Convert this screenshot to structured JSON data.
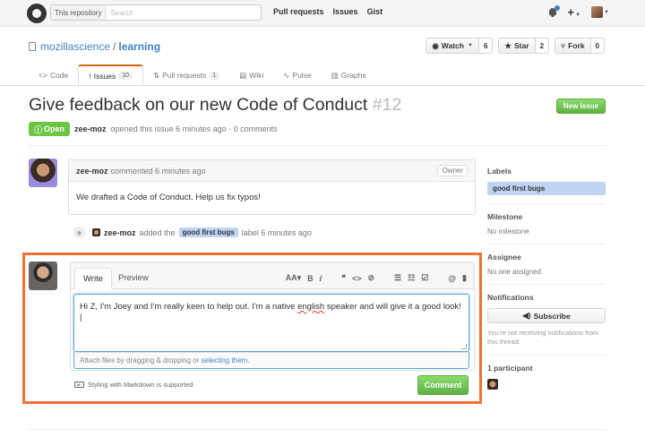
{
  "header": {
    "search_scope": "This repository",
    "search_placeholder": "Search",
    "nav": [
      "Pull requests",
      "Issues",
      "Gist"
    ],
    "plus_label": "+"
  },
  "repo": {
    "owner": "mozillascience",
    "separator": "/",
    "name": "learning",
    "watch_label": "Watch",
    "watch_count": "6",
    "star_label": "Star",
    "star_count": "2",
    "fork_label": "Fork",
    "fork_count": "0",
    "tabs": [
      {
        "icon": "<>",
        "label": "Code"
      },
      {
        "icon": "!",
        "label": "Issues",
        "count": "10"
      },
      {
        "icon": "⇅",
        "label": "Pull requests",
        "count": "1"
      },
      {
        "icon": "▤",
        "label": "Wiki"
      },
      {
        "icon": "∿",
        "label": "Pulse"
      },
      {
        "icon": "▥",
        "label": "Graphs"
      }
    ]
  },
  "issue": {
    "title": "Give feedback on our new Code of Conduct",
    "number": "#12",
    "new_issue_label": "New Issue",
    "state": "Open",
    "author": "zee-moz",
    "meta": "opened this issue 6 minutes ago · 0 comments"
  },
  "comment": {
    "author": "zee-moz",
    "meta": "commented 6 minutes ago",
    "badge": "Owner",
    "body": "We drafted a Code of Conduct. Help us fix typos!"
  },
  "event": {
    "author": "zee-moz",
    "text_before": "added the",
    "label": "good first bugs",
    "text_after": "label 6 minutes ago"
  },
  "editor": {
    "tab_write": "Write",
    "tab_preview": "Preview",
    "toolbar": [
      "AA▾",
      "B",
      "i",
      "❝",
      "<>",
      "⊘",
      "☰",
      "☷",
      "☑",
      "@",
      "▮"
    ],
    "text_before": "Hi Z, I'm Joey and I'm really keen to help out. I'm a native",
    "text_misspelled": "english",
    "text_after": "speaker and will give it a good look! |",
    "attach_text": "Attach files by dragging & dropping or",
    "attach_link": "selecting them.",
    "markdown_hint": "Styling with Markdown is supported",
    "comment_button": "Comment"
  },
  "sidebar": {
    "labels_title": "Labels",
    "label": "good first bugs",
    "milestone_title": "Milestone",
    "milestone_value": "No milestone",
    "assignee_title": "Assignee",
    "assignee_value": "No one assigned",
    "notifications_title": "Notifications",
    "subscribe_label": "Subscribe",
    "notifications_note": "You're not receiving notifications from this thread.",
    "participants_title": "1 participant"
  },
  "colors": {
    "accent_orange": "#f07230",
    "green": "#6cc644",
    "link_blue": "#4183c4",
    "label_blue": "#bfd4f2"
  }
}
